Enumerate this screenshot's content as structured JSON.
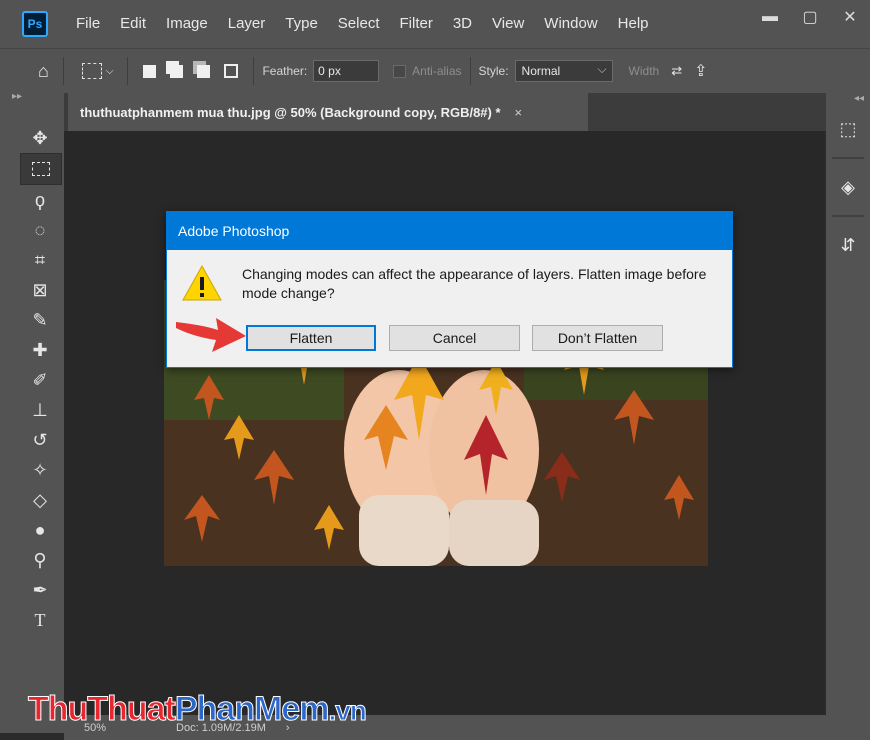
{
  "app": {
    "logo": "Ps",
    "menu": [
      "File",
      "Edit",
      "Image",
      "Layer",
      "Type",
      "Select",
      "Filter",
      "3D",
      "View",
      "Window",
      "Help"
    ]
  },
  "options": {
    "feather_label": "Feather:",
    "feather_value": "0 px",
    "antialias_label": "Anti-alias",
    "style_label": "Style:",
    "style_value": "Normal",
    "width_label": "Width"
  },
  "document": {
    "tab_title": "thuthuatphanmem mua thu.jpg @ 50% (Background copy, RGB/8#) *",
    "tab_close": "×"
  },
  "status": {
    "zoom": "50%",
    "doc_info": "Doc: 1.09M/2.19M"
  },
  "dialog": {
    "title": "Adobe Photoshop",
    "message": "Changing modes can affect the appearance of layers.  Flatten image before mode change?",
    "buttons": {
      "flatten": "Flatten",
      "cancel": "Cancel",
      "dont_flatten": "Don’t Flatten"
    }
  },
  "watermark": {
    "part1": "ThuThuat",
    "part2": "PhanMem",
    "part3": ".vn"
  },
  "colors": {
    "accent": "#0078d7",
    "ps_blue": "#31a8ff",
    "arrow_red": "#e53935",
    "warning_yellow": "#ffd400"
  }
}
